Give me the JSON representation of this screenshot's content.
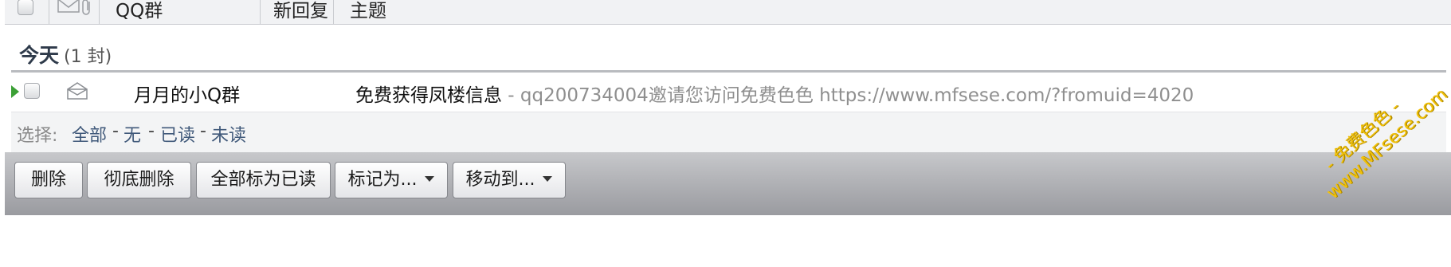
{
  "header": {
    "columns": {
      "group": "QQ群",
      "new_reply": "新回复",
      "subject": "主题"
    }
  },
  "group": {
    "title": "今天",
    "count": "(1 封)"
  },
  "mail": {
    "sender": "月月的小Q群",
    "subject": "免费获得凤楼信息",
    "preview": " - qq200734004邀请您访问免费色色 https://www.mfsese.com/?fromuid=4020"
  },
  "select": {
    "label": "选择:",
    "all": "全部",
    "none": "无",
    "read": "已读",
    "unread": "未读",
    "sep": "-"
  },
  "toolbar": {
    "delete": "删除",
    "delete_permanent": "彻底删除",
    "mark_all_read": "全部标为已读",
    "mark_as": "标记为...",
    "move_to": "移动到..."
  },
  "watermark": {
    "line1": "- 免费色色 -",
    "line2": "www.MFsese.com"
  },
  "colors": {
    "accent_green": "#3ba035",
    "link": "#40597a",
    "watermark": "#f2c20a"
  }
}
